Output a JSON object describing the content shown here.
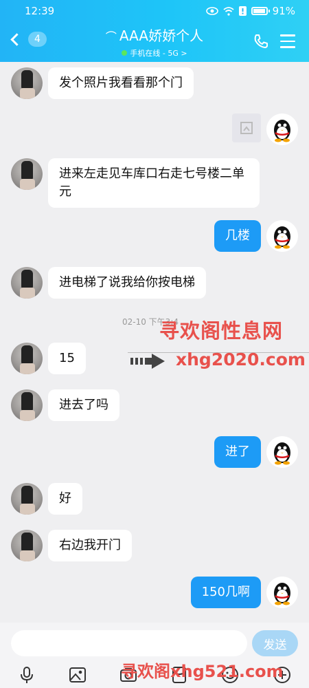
{
  "status_bar": {
    "time": "12:39",
    "battery": "91%"
  },
  "header": {
    "back_badge": "4",
    "title": "AAA娇娇个人",
    "subtitle": "手机在线 - 5G >"
  },
  "messages": [
    {
      "side": "left",
      "text": "发个照片我看看那个门"
    },
    {
      "side": "right",
      "type": "image"
    },
    {
      "side": "left",
      "text": "进来左走见车库口右走七号楼二单元"
    },
    {
      "side": "right",
      "text": "几楼"
    },
    {
      "side": "left",
      "text": "进电梯了说我给你按电梯"
    },
    {
      "type": "timestamp",
      "text": "02-10 下午3:4"
    },
    {
      "side": "left",
      "text": "15"
    },
    {
      "side": "left",
      "text": "进去了吗"
    },
    {
      "side": "right",
      "text": "进了"
    },
    {
      "side": "left",
      "text": "好"
    },
    {
      "side": "left",
      "text": "右边我开门"
    },
    {
      "side": "right",
      "text": "150几啊"
    }
  ],
  "watermarks": {
    "line1": "寻欢阁性息网",
    "line2": "xhg2020.com",
    "line3": "寻欢阁xhg521.com"
  },
  "input": {
    "placeholder": "",
    "send_label": "发送"
  },
  "toolbar": [
    "mic-icon",
    "image-icon",
    "camera-icon",
    "red-packet-icon",
    "emoji-icon",
    "plus-icon"
  ],
  "colors": {
    "header": "#1ec5f8",
    "my_bubble": "#1d9bf6",
    "watermark": "#e8514c"
  }
}
